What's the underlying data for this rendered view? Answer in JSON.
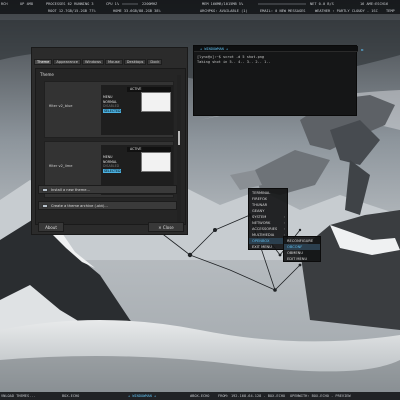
{
  "topbar": {
    "row1": [
      "RCH",
      "UP 4M8",
      "PROCESSES 62  RUNNING 3",
      "CPU 1%",
      "2200MHZ",
      "MEM 166MB/1015MB  5%",
      "NET 0.0 B/S",
      "16 AME:ESCH16"
    ],
    "row2": [
      "ROOT 12.7GB/15.2GB  77%",
      "HOME 33.6GB/88.2GB  38%",
      "ARCHPKG: AVAILABLE (1)",
      "EMAIL: 0 NEW MESSAGES",
      "WEATHER : PARTLY CLOUDY - 1SC",
      "TEMP"
    ]
  },
  "bottombar": {
    "items": [
      "VNLOAD THEMES...",
      "BOX-ECHO",
      "#BOX-ECHO",
      "FROM: 192.168.64.128 - BOX-ECHO",
      "OPENWITH: BOX-ECHO - PREVIEW"
    ],
    "active_workspace": "+ WINDOWMAN +"
  },
  "theme_window": {
    "tabs": [
      "Theme",
      "Appearance",
      "Windows",
      "Mouse",
      "Desktops",
      "Dock"
    ],
    "panel_title": "Theme",
    "themes": [
      {
        "name": "filter v2_blue",
        "preview": {
          "title": "ACTIVE",
          "menu": "MENU",
          "normal": "NORMAL",
          "disabled": "DISABLED",
          "selected": "SELECTED"
        }
      },
      {
        "name": "filter v2_lime",
        "preview": {
          "title": "ACTIVE",
          "menu": "MENU",
          "normal": "NORMAL",
          "disabled": "DISABLED",
          "selected": "SELECTED"
        }
      }
    ],
    "install_label": "Install a new theme...",
    "create_label": "Create a theme archive (.obt)...",
    "about_label": "About",
    "close_label": "Close"
  },
  "terminal": {
    "title": "WINDOWMAN",
    "lines": [
      "[lynx@x]:~$  scrot -d 5 shot.png",
      "Taking shot in 5.. 4.. 3.. 2.. 1.."
    ]
  },
  "desktop_menu": {
    "main": [
      "TERMINAL",
      "FIREFOX",
      "THUNAR",
      "GEANY",
      "SYSTEM",
      "NETWORK",
      "ACCESSORIES",
      "MULTIMEDIA",
      "OPENBOX",
      "EXIT MENU"
    ],
    "main_highlight_index": 8,
    "sub": [
      "RECONFIGURE",
      "OBCONF",
      "OBMENU",
      "EDIT MENU"
    ],
    "sub_highlight_index": 1
  }
}
